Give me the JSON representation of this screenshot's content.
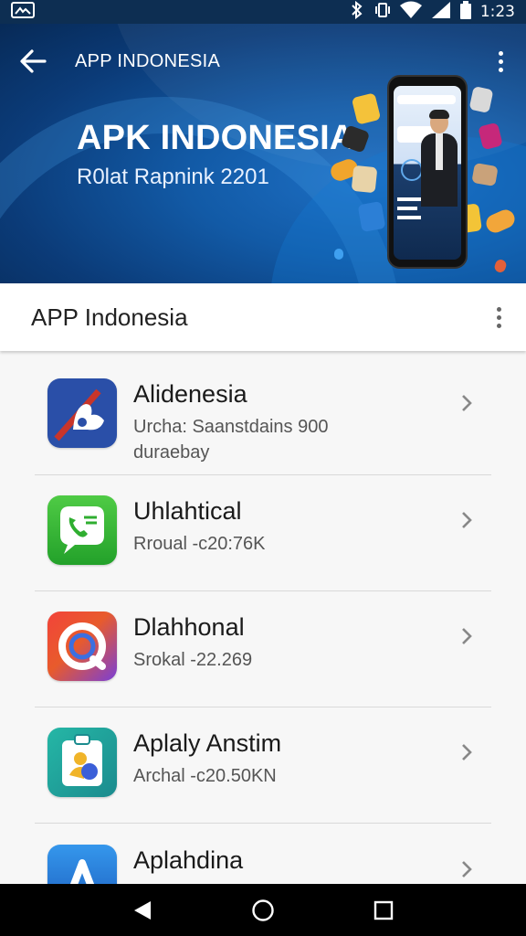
{
  "status_bar": {
    "time": "1:23",
    "icons": [
      "image-notification-icon",
      "bluetooth-icon",
      "vibrate-icon",
      "wifi-icon",
      "signal-icon",
      "battery-icon"
    ]
  },
  "appbar": {
    "title": "APP INDONESIA",
    "back_icon": "arrow-back-icon",
    "menu_icon": "more-vert-icon"
  },
  "hero": {
    "title": "APK INDONESIA",
    "subtitle": "R0lat Rapnink 2201",
    "colors": {
      "bg_dark": "#072a57",
      "bg_mid": "#125aa6",
      "bg_light": "#1d6fc4"
    }
  },
  "section": {
    "title": "APP Indonesia",
    "menu_icon": "more-vert-icon"
  },
  "apps": [
    {
      "name": "Alidenesia",
      "line1": "Urcha: Saanstdains 900",
      "line2": "duraebay",
      "icon": "delivery-icon",
      "colors": [
        "#2a4fa8",
        "#c8352a"
      ]
    },
    {
      "name": "Uhlahtical",
      "line1": "Rroual  -c20:76K",
      "icon": "phone-chat-icon",
      "colors": [
        "#3fbf3a",
        "#27a02c"
      ]
    },
    {
      "name": "Dlahhonal",
      "line1": "Srokal  -22.269",
      "icon": "ring-icon",
      "colors": [
        "#e8433c",
        "#7a3fd6"
      ]
    },
    {
      "name": "Aplaly Anstim",
      "line1": "Archal  -c20.50KN",
      "icon": "clipboard-person-icon",
      "colors": [
        "#1fa59a",
        "#2a6fd1"
      ]
    },
    {
      "name": "Aplahdina",
      "line1": "",
      "icon": "letter-a-icon",
      "colors": [
        "#2a86e2",
        "#1c5fc0"
      ]
    }
  ],
  "nav": {
    "back_icon": "nav-back-icon",
    "home_icon": "nav-home-icon",
    "recents_icon": "nav-recents-icon"
  }
}
